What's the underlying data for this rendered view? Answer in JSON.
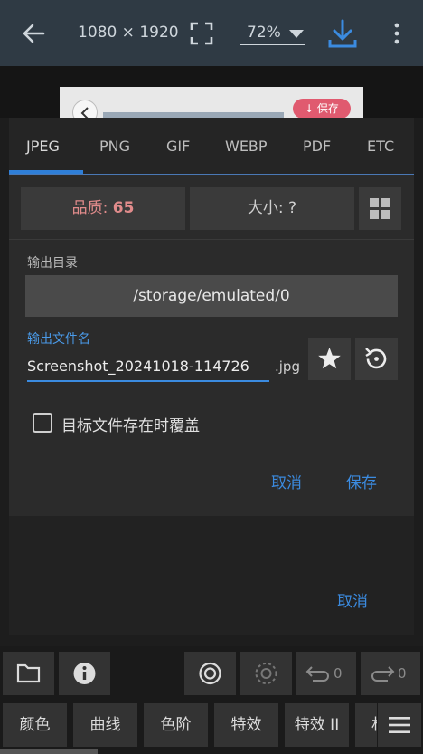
{
  "topbar": {
    "dimensions": "1080 × 1920",
    "zoom": "72%"
  },
  "preview": {
    "save_pill": "↓ 保存"
  },
  "format_tabs": [
    "JPEG",
    "PNG",
    "GIF",
    "WEBP",
    "PDF",
    "ETC"
  ],
  "active_tab": "JPEG",
  "quality": {
    "label": "品质: ",
    "value": "65"
  },
  "size": {
    "label": "大小: ?"
  },
  "output_dir": {
    "label": "输出目录",
    "value": "/storage/emulated/0"
  },
  "output_file": {
    "label": "输出文件名",
    "value": "Screenshot_20241018-114726",
    "extension": ".jpg"
  },
  "overwrite": {
    "label": "目标文件存在时覆盖",
    "checked": false
  },
  "dialog_actions": {
    "cancel": "取消",
    "save": "保存"
  },
  "under_panel": {
    "cancel": "取消"
  },
  "toolbar": {
    "undo_count": "0",
    "redo_count": "0"
  },
  "filters": [
    "颜色",
    "曲线",
    "色阶",
    "特效",
    "特效 II",
    "材"
  ],
  "colors": {
    "accent": "#3b8be0",
    "quality_text": "#e08b8b",
    "topbar_bg": "#2f3a44"
  }
}
